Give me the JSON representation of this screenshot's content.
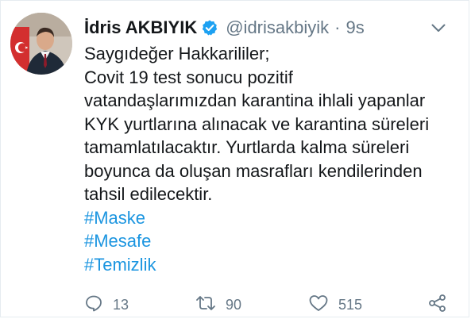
{
  "tweet": {
    "author": {
      "name": "İdris AKBIYIK",
      "handle": "@idrisakbiyik",
      "verified": true
    },
    "separator": "·",
    "timestamp": "9s",
    "text_lines": [
      "Saygıdeğer Hakkarililer;",
      "Covit 19 test sonucu pozitif",
      "vatandaşlarımızdan karantina ihlali yapanlar",
      "KYK yurtlarına alınacak ve karantina süreleri",
      "tamamlatılacaktır. Yurtlarda kalma süreleri",
      "boyunca da oluşan masrafları kendilerinden",
      "tahsil edilecektir."
    ],
    "hashtags": [
      "#Maske",
      "#Mesafe",
      "#Temizlik"
    ],
    "actions": {
      "reply_count": "13",
      "retweet_count": "90",
      "like_count": "515"
    }
  },
  "icons": {
    "verified": "verified-badge-icon",
    "menu": "chevron-down-icon",
    "reply": "reply-icon",
    "retweet": "retweet-icon",
    "like": "heart-icon",
    "share": "share-icon"
  },
  "colors": {
    "text": "#14171a",
    "muted": "#657786",
    "link": "#1b95e0",
    "verified": "#1da1f2",
    "border": "#e6ecf0"
  }
}
